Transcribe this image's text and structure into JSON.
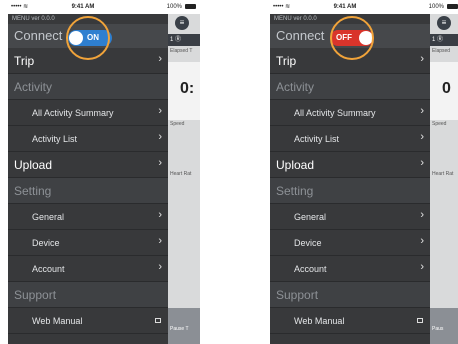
{
  "status_bar": {
    "signal": "••••• ≋",
    "time": "9:41 AM",
    "battery": "100%"
  },
  "menu": {
    "version": "MENU  ver 0.0.0",
    "connect_label": "Connect",
    "trip": "Trip",
    "activity_section": "Activity",
    "all_activity_summary": "All Activity Summary",
    "activity_list": "Activity List",
    "upload": "Upload",
    "setting_section": "Setting",
    "general": "General",
    "device": "Device",
    "account": "Account",
    "support_section": "Support",
    "web_manual": "Web Manual"
  },
  "screens": [
    {
      "toggle_state": "on",
      "toggle_text": "ON"
    },
    {
      "toggle_state": "off",
      "toggle_text": "OFF"
    }
  ],
  "content": {
    "menu_icon": "hamburger-icon",
    "stop_tab_left": "1 Ⓡ",
    "stop_tab_right": "1 Ⓡ",
    "elapsed_left": "Elapsed T",
    "elapsed_right": "Elapsed",
    "time_left": "0:",
    "time_right": "0",
    "speed": "Speed",
    "heart_left": "Heart Rat",
    "heart_right": "Heart Rat",
    "pause_left": "Pause T",
    "pause_right": "Paus"
  },
  "colors": {
    "menu_bg": "#38393b",
    "toggle_on": "#2e7fd0",
    "toggle_off": "#d9342b",
    "highlight_ring": "#f0a33a"
  }
}
